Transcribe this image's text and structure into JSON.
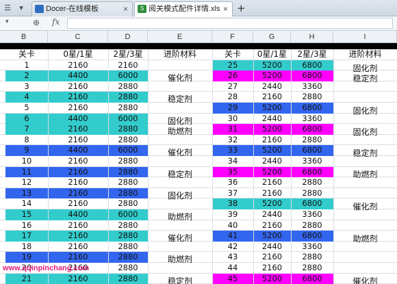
{
  "tabbar": {
    "tab1": "Docer-在线模板",
    "tab2": "阅关模式配件详情.xls"
  },
  "columns": [
    "B",
    "C",
    "D",
    "E",
    "F",
    "G",
    "H",
    "I"
  ],
  "header": {
    "level": "关卡",
    "c1": "0星/1星",
    "c2": "2星/3星",
    "mat": "进阶材料"
  },
  "colors": {
    "teal": "#33cccc",
    "blue": "#3366ee",
    "magenta": "#ff00ff",
    "white": "#ffffff"
  },
  "left_rows": [
    {
      "level": "1",
      "a": "2160",
      "b": "2160",
      "color": "white"
    },
    {
      "level": "2",
      "a": "4400",
      "b": "6000",
      "color": "teal"
    },
    {
      "level": "3",
      "a": "2160",
      "b": "2880",
      "color": "white"
    },
    {
      "level": "4",
      "a": "2160",
      "b": "2880",
      "color": "teal"
    },
    {
      "level": "5",
      "a": "2160",
      "b": "2880",
      "color": "white"
    },
    {
      "level": "6",
      "a": "4400",
      "b": "6000",
      "color": "teal"
    },
    {
      "level": "7",
      "a": "2160",
      "b": "2880",
      "color": "teal"
    },
    {
      "level": "8",
      "a": "2160",
      "b": "2880",
      "color": "white"
    },
    {
      "level": "9",
      "a": "4400",
      "b": "6000",
      "color": "blue"
    },
    {
      "level": "10",
      "a": "2160",
      "b": "2880",
      "color": "white"
    },
    {
      "level": "11",
      "a": "2160",
      "b": "2880",
      "color": "blue"
    },
    {
      "level": "12",
      "a": "2160",
      "b": "2880",
      "color": "white"
    },
    {
      "level": "13",
      "a": "2160",
      "b": "2880",
      "color": "blue"
    },
    {
      "level": "14",
      "a": "2160",
      "b": "2880",
      "color": "white"
    },
    {
      "level": "15",
      "a": "4400",
      "b": "6000",
      "color": "teal"
    },
    {
      "level": "16",
      "a": "2160",
      "b": "2880",
      "color": "white"
    },
    {
      "level": "17",
      "a": "2160",
      "b": "2880",
      "color": "teal"
    },
    {
      "level": "18",
      "a": "2160",
      "b": "2880",
      "color": "white"
    },
    {
      "level": "19",
      "a": "2160",
      "b": "2880",
      "color": "blue"
    },
    {
      "level": "20",
      "a": "2160",
      "b": "2880",
      "color": "white"
    },
    {
      "level": "21",
      "a": "2160",
      "b": "2880",
      "color": "teal"
    }
  ],
  "right_rows": [
    {
      "level": "25",
      "a": "5200",
      "b": "6800",
      "color": "teal"
    },
    {
      "level": "26",
      "a": "5200",
      "b": "6800",
      "color": "magenta"
    },
    {
      "level": "27",
      "a": "2440",
      "b": "3360",
      "color": "white"
    },
    {
      "level": "28",
      "a": "2160",
      "b": "2880",
      "color": "white"
    },
    {
      "level": "29",
      "a": "5200",
      "b": "6800",
      "color": "blue"
    },
    {
      "level": "30",
      "a": "2440",
      "b": "3360",
      "color": "white"
    },
    {
      "level": "31",
      "a": "5200",
      "b": "6800",
      "color": "magenta"
    },
    {
      "level": "32",
      "a": "2160",
      "b": "2880",
      "color": "white"
    },
    {
      "level": "33",
      "a": "5200",
      "b": "6800",
      "color": "blue"
    },
    {
      "level": "34",
      "a": "2440",
      "b": "3360",
      "color": "white"
    },
    {
      "level": "35",
      "a": "5200",
      "b": "6800",
      "color": "magenta"
    },
    {
      "level": "36",
      "a": "2160",
      "b": "2880",
      "color": "white"
    },
    {
      "level": "37",
      "a": "2160",
      "b": "2880",
      "color": "white"
    },
    {
      "level": "38",
      "a": "5200",
      "b": "6800",
      "color": "teal"
    },
    {
      "level": "39",
      "a": "2440",
      "b": "3360",
      "color": "white"
    },
    {
      "level": "40",
      "a": "2160",
      "b": "2880",
      "color": "white"
    },
    {
      "level": "41",
      "a": "5200",
      "b": "6800",
      "color": "blue"
    },
    {
      "level": "42",
      "a": "2440",
      "b": "3360",
      "color": "white"
    },
    {
      "level": "43",
      "a": "2160",
      "b": "2880",
      "color": "white"
    },
    {
      "level": "44",
      "a": "2160",
      "b": "2880",
      "color": "white"
    },
    {
      "level": "45",
      "a": "5200",
      "b": "6800",
      "color": "magenta"
    }
  ],
  "materials_left": [
    "催化剂",
    "稳定剂",
    "固化剂",
    "助燃剂",
    "催化剂",
    "稳定剂",
    "固化剂",
    "助燃剂",
    "催化剂",
    "助燃剂",
    "稳定剂"
  ],
  "materials_right": [
    "固化剂",
    "稳定剂",
    "固化剂",
    "固化剂",
    "稳定剂",
    "助燃剂",
    "催化剂",
    "助燃剂",
    "催化剂"
  ],
  "watermark": "www.qqinpinchang.com"
}
